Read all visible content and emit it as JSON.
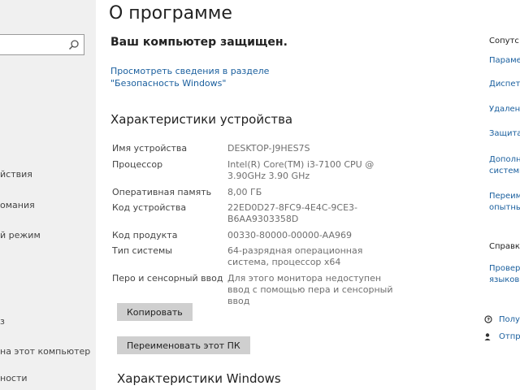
{
  "nav": {
    "items": [
      "йствия",
      "омания",
      "й режим",
      "з",
      "на этот компьютер",
      "ности"
    ]
  },
  "main": {
    "title": "О программе",
    "protection_status": "Ваш компьютер защищен.",
    "security_link": "Просмотреть сведения в разделе \"Безопасность Windows\"",
    "device_specs_title": "Характеристики устройства",
    "specs": [
      {
        "label": "Имя устройства",
        "value": "DESKTOP-J9HES7S"
      },
      {
        "label": "Процессор",
        "value": "Intel(R) Core(TM) i3-7100 CPU @ 3.90GHz 3.90 GHz"
      },
      {
        "label": "Оперативная память",
        "value": "8,00 ГБ"
      },
      {
        "label": "Код устройства",
        "value": "22ED0D27-8FC9-4E4C-9CE3-B6AA9303358D"
      },
      {
        "label": "Код продукта",
        "value": "00330-80000-00000-AA969"
      },
      {
        "label": "Тип системы",
        "value": "64-разрядная операционная система, процессор x64"
      },
      {
        "label": "Перо и сенсорный ввод",
        "value": "Для этого монитора недоступен ввод с помощью пера и сенсорный ввод"
      }
    ],
    "copy_button": "Копировать",
    "rename_button": "Переименовать этот ПК",
    "windows_specs_title": "Характеристики Windows"
  },
  "right_panel": {
    "section1_title": "Сопутс",
    "links1": [
      "Парамет",
      "Диспет",
      "Удален",
      "Защита",
      "Дополн",
      "системы",
      "Переим",
      "опытных"
    ],
    "section2_title": "Справка",
    "links2": [
      "Проверка",
      "языков"
    ],
    "help_links": [
      "Полу",
      "Отпр"
    ]
  },
  "colors": {
    "link": "#1a5f9e",
    "button": "#cfcfcf",
    "left_pane": "#f0f0f0"
  },
  "icons": {
    "search": "search-icon",
    "help": "help-chat-icon",
    "feedback": "feedback-icon"
  }
}
